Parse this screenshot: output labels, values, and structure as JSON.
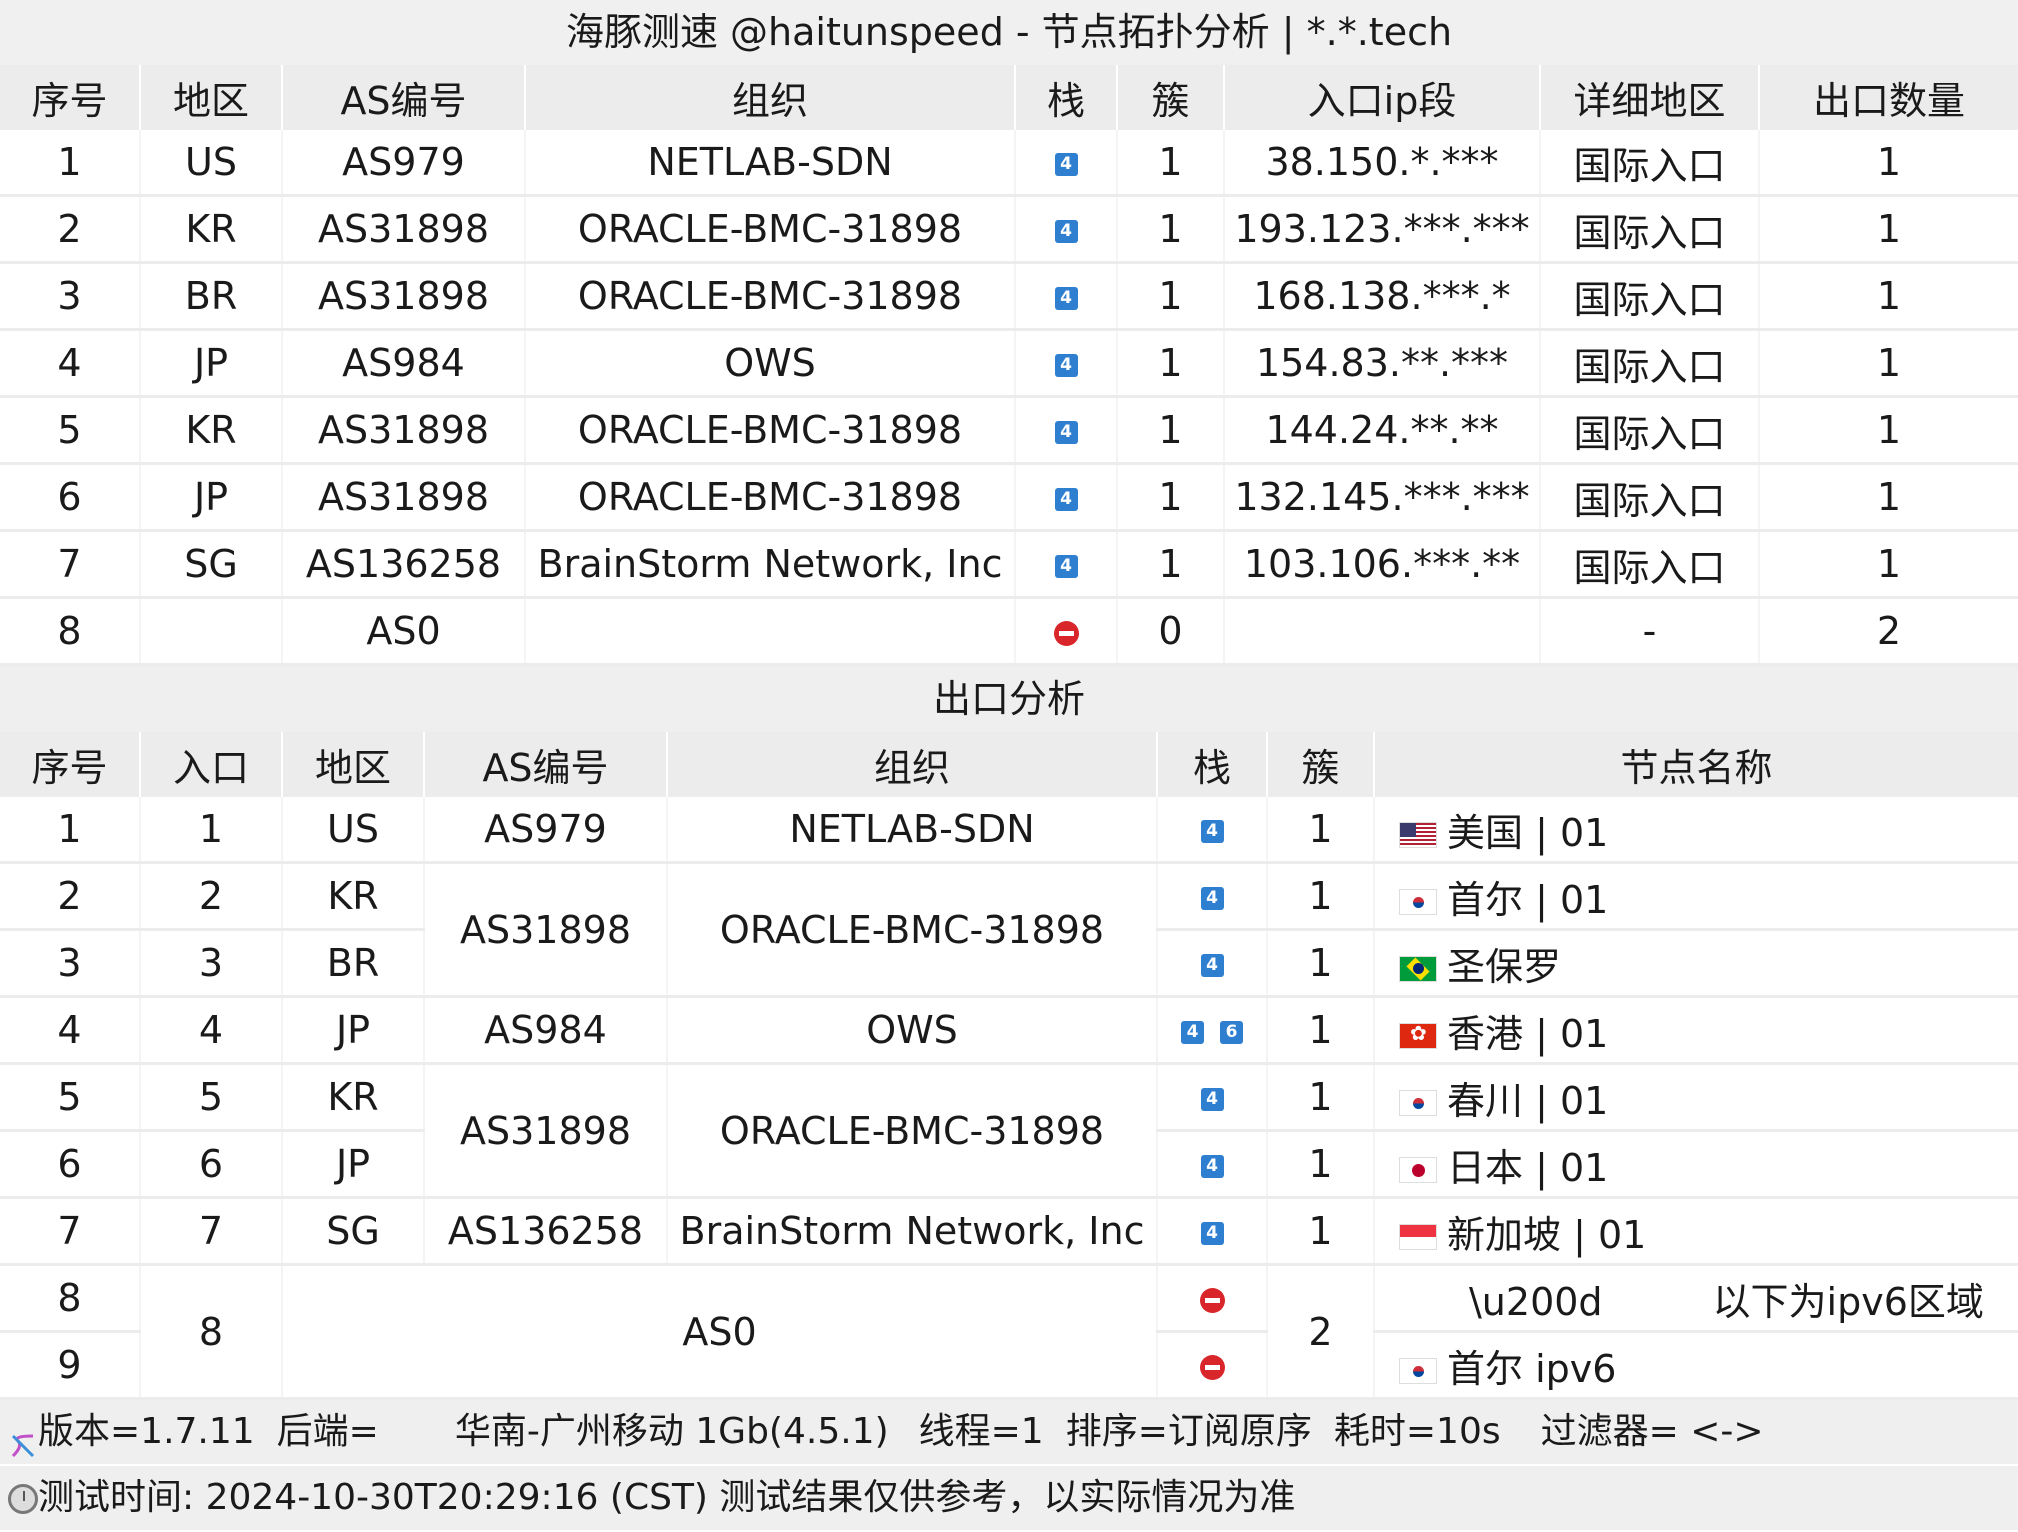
{
  "title": "海豚测速 @haitunspeed - 节点拓扑分析 | *.*.tech",
  "entry_table": {
    "headers": [
      "序号",
      "地区",
      "AS编号",
      "组织",
      "栈",
      "簇",
      "入口ip段",
      "详细地区",
      "出口数量"
    ],
    "rows": [
      {
        "idx": "1",
        "region": "US",
        "asn": "AS979",
        "org": "NETLAB-SDN",
        "stack": "4",
        "cluster": "1",
        "ip": "38.150.*.***",
        "detail": "国际入口",
        "exits": "1"
      },
      {
        "idx": "2",
        "region": "KR",
        "asn": "AS31898",
        "org": "ORACLE-BMC-31898",
        "stack": "4",
        "cluster": "1",
        "ip": "193.123.***.***",
        "detail": "国际入口",
        "exits": "1"
      },
      {
        "idx": "3",
        "region": "BR",
        "asn": "AS31898",
        "org": "ORACLE-BMC-31898",
        "stack": "4",
        "cluster": "1",
        "ip": "168.138.***.*",
        "detail": "国际入口",
        "exits": "1"
      },
      {
        "idx": "4",
        "region": "JP",
        "asn": "AS984",
        "org": "OWS",
        "stack": "4",
        "cluster": "1",
        "ip": "154.83.**.***",
        "detail": "国际入口",
        "exits": "1"
      },
      {
        "idx": "5",
        "region": "KR",
        "asn": "AS31898",
        "org": "ORACLE-BMC-31898",
        "stack": "4",
        "cluster": "1",
        "ip": "144.24.**.**",
        "detail": "国际入口",
        "exits": "1"
      },
      {
        "idx": "6",
        "region": "JP",
        "asn": "AS31898",
        "org": "ORACLE-BMC-31898",
        "stack": "4",
        "cluster": "1",
        "ip": "132.145.***.***",
        "detail": "国际入口",
        "exits": "1"
      },
      {
        "idx": "7",
        "region": "SG",
        "asn": "AS136258",
        "org": "BrainStorm Network, Inc",
        "stack": "4",
        "cluster": "1",
        "ip": "103.106.***.**",
        "detail": "国际入口",
        "exits": "1"
      },
      {
        "idx": "8",
        "region": "",
        "asn": "AS0",
        "org": "",
        "stack": "none",
        "cluster": "0",
        "ip": "",
        "detail": "-",
        "exits": "2"
      }
    ]
  },
  "exit_section_title": "出口分析",
  "exit_table": {
    "headers": [
      "序号",
      "入口",
      "地区",
      "AS编号",
      "组织",
      "栈",
      "簇",
      "节点名称"
    ],
    "rows": [
      {
        "idx": "1",
        "entry": "1",
        "region": "US",
        "asn": "AS979",
        "org": "NETLAB-SDN",
        "cluster": "1",
        "flag": "us",
        "name": "美国 | 01"
      },
      {
        "idx": "2",
        "entry": "2",
        "region": "KR",
        "asn": "AS31898",
        "org": "ORACLE-BMC-31898",
        "cluster": "1",
        "flag": "kr",
        "name": "首尔  | 01"
      },
      {
        "idx": "3",
        "entry": "3",
        "region": "BR",
        "cluster": "1",
        "flag": "br",
        "name": "圣保罗"
      },
      {
        "idx": "4",
        "entry": "4",
        "region": "JP",
        "asn": "AS984",
        "org": "OWS",
        "cluster": "1",
        "flag": "hk",
        "name": "香港 | 01"
      },
      {
        "idx": "5",
        "entry": "5",
        "region": "KR",
        "asn": "AS31898",
        "org": "ORACLE-BMC-31898",
        "cluster": "1",
        "flag": "kr",
        "name": "春川  | 01"
      },
      {
        "idx": "6",
        "entry": "6",
        "region": "JP",
        "cluster": "1",
        "flag": "jp",
        "name": "日本  | 01"
      },
      {
        "idx": "7",
        "entry": "7",
        "region": "SG",
        "asn": "AS136258",
        "org": "BrainStorm Network, Inc",
        "cluster": "1",
        "flag": "sg",
        "name": "新加坡 | 01"
      },
      {
        "idx": "8",
        "entry": "8",
        "asn": "AS0",
        "cluster": "2",
        "name_a": "\\u200d",
        "name_b": "以下为ipv6区域"
      },
      {
        "idx": "9",
        "flag": "kr",
        "name": "首尔  ipv6"
      }
    ]
  },
  "stack_icons": {
    "v4": "4",
    "v6": "6",
    "none_icon": "no-entry-icon"
  },
  "footer": {
    "line1_icon": "dna-icon",
    "version": "版本=1.7.11",
    "backend": "后端=",
    "backend_value": "华南-广州移动 1Gb(4.5.1)",
    "threads": "线程=1",
    "sort": "排序=订阅原序",
    "elapsed": "耗时=10s",
    "filter": "过滤器= <->",
    "line2_icon": "clock-icon",
    "test_time": "测试时间: 2024-10-30T20:29:16 (CST)  测试结果仅供参考，以实际情况为准"
  },
  "colors": {
    "stack_badge": "#2f7fd1",
    "no_entry": "#d9262a",
    "header_bg": "#ececec"
  }
}
